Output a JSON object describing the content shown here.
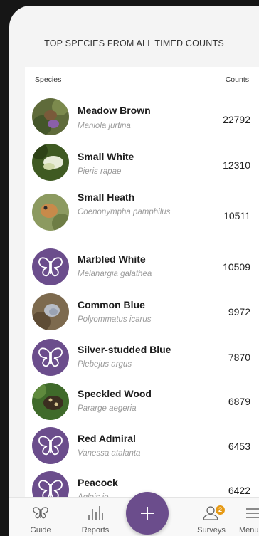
{
  "page": {
    "title": "TOP SPECIES FROM ALL TIMED COUNTS"
  },
  "table": {
    "headers": {
      "species": "Species",
      "counts": "Counts"
    },
    "rows": [
      {
        "name": "Meadow Brown",
        "latin": "Maniola jurtina",
        "count": "22792",
        "avatar": "photo"
      },
      {
        "name": "Small White",
        "latin": "Pieris rapae",
        "count": "12310",
        "avatar": "photo"
      },
      {
        "name": "Small Heath",
        "latin": "Coenonympha pamphilus",
        "count": "10511",
        "avatar": "photo"
      },
      {
        "name": "Marbled White",
        "latin": "Melanargia galathea",
        "count": "10509",
        "avatar": "butterfly-icon"
      },
      {
        "name": "Common Blue",
        "latin": "Polyommatus icarus",
        "count": "9972",
        "avatar": "photo"
      },
      {
        "name": "Silver-studded Blue",
        "latin": "Plebejus argus",
        "count": "7870",
        "avatar": "butterfly-icon"
      },
      {
        "name": "Speckled Wood",
        "latin": "Pararge aegeria",
        "count": "6879",
        "avatar": "photo"
      },
      {
        "name": "Red Admiral",
        "latin": "Vanessa atalanta",
        "count": "6453",
        "avatar": "butterfly-icon"
      },
      {
        "name": "Peacock",
        "latin": "Aglais io",
        "count": "6422",
        "avatar": "butterfly-icon"
      }
    ]
  },
  "tabbar": {
    "guide": "Guide",
    "reports": "Reports",
    "surveys": "Surveys",
    "surveys_badge": "2",
    "menu": "Menu",
    "add_icon": "plus-icon"
  },
  "colors": {
    "accent": "#6b4d8c",
    "badge": "#e69a16"
  }
}
